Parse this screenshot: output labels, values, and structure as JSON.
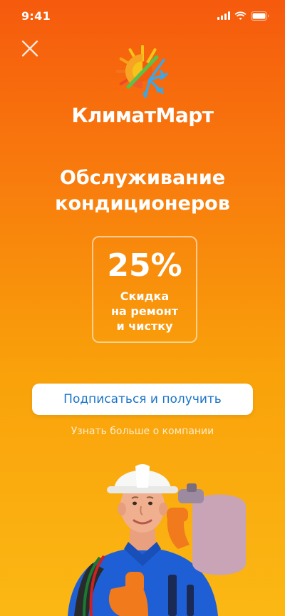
{
  "status_bar": {
    "time": "9:41"
  },
  "brand": {
    "name": "КлиматМарт"
  },
  "promo": {
    "headline_line1": "Обслуживание",
    "headline_line2": "кондиционеров",
    "discount_value": "25%",
    "discount_line1": "Скидка",
    "discount_line2": "на ремонт",
    "discount_line3": "и чистку"
  },
  "actions": {
    "subscribe_label": "Подписаться и получить",
    "learn_more_label": "Узнать больше о компании"
  },
  "colors": {
    "gradient_top": "#f65a0d",
    "gradient_bottom": "#fbb814",
    "cta_text": "#1a73c9",
    "logo_sun": "#f7c21a",
    "logo_snow": "#3aa7e8",
    "logo_green": "#5cc04a"
  },
  "icons": {
    "close": "close-icon",
    "logo": "sun-snowflake-logo-icon",
    "signal": "signal-icon",
    "wifi": "wifi-icon",
    "battery": "battery-icon"
  }
}
